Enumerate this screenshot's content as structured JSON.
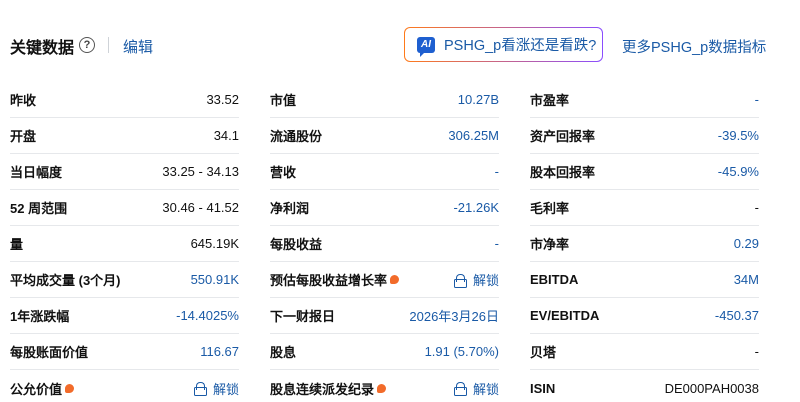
{
  "header": {
    "title": "关键数据",
    "help_glyph": "?",
    "edit_label": "编辑",
    "ai_badge": "AI",
    "ai_button_label": "PSHG_p看涨还是看跌?",
    "more_link": "更多PSHG_p数据指标"
  },
  "unlock_label": "解锁",
  "columns": [
    {
      "rows": [
        {
          "label": "昨收",
          "value": "33.52",
          "link": false
        },
        {
          "label": "开盘",
          "value": "34.1",
          "link": false
        },
        {
          "label": "当日幅度",
          "value": "33.25 - 34.13",
          "link": false
        },
        {
          "label": "52 周范围",
          "value": "30.46 - 41.52",
          "link": false
        },
        {
          "label": "量",
          "value": "645.19K",
          "link": false
        },
        {
          "label": "平均成交量 (3个月)",
          "value": "550.91K",
          "link": true
        },
        {
          "label": "1年涨跌幅",
          "value": "-14.4025%",
          "link": true
        },
        {
          "label": "每股账面价值",
          "value": "116.67",
          "link": true
        },
        {
          "label": "公允价值",
          "value": "解锁",
          "pro": true,
          "locked": true
        }
      ]
    },
    {
      "rows": [
        {
          "label": "市值",
          "value": "10.27B",
          "link": true
        },
        {
          "label": "流通股份",
          "value": "306.25M",
          "link": true
        },
        {
          "label": "营收",
          "value": "-",
          "link": true
        },
        {
          "label": "净利润",
          "value": "-21.26K",
          "link": true
        },
        {
          "label": "每股收益",
          "value": "-",
          "link": true
        },
        {
          "label": "预估每股收益增长率",
          "value": "解锁",
          "pro": true,
          "locked": true
        },
        {
          "label": "下一财报日",
          "value": "2026年3月26日",
          "link": true
        },
        {
          "label": "股息",
          "value": "1.91 (5.70%)",
          "link": true
        },
        {
          "label": "股息连续派发纪录",
          "value": "解锁",
          "pro": true,
          "locked": true
        }
      ]
    },
    {
      "rows": [
        {
          "label": "市盈率",
          "value": "-",
          "link": true
        },
        {
          "label": "资产回报率",
          "value": "-39.5%",
          "link": true
        },
        {
          "label": "股本回报率",
          "value": "-45.9%",
          "link": true
        },
        {
          "label": "毛利率",
          "value": "-",
          "link": false
        },
        {
          "label": "市净率",
          "value": "0.29",
          "link": true
        },
        {
          "label": "EBITDA",
          "value": "34M",
          "link": true
        },
        {
          "label": "EV/EBITDA",
          "value": "-450.37",
          "link": true
        },
        {
          "label": "贝塔",
          "value": "-",
          "link": false
        },
        {
          "label": "ISIN",
          "value": "DE000PAH0038",
          "link": false
        }
      ]
    }
  ]
}
